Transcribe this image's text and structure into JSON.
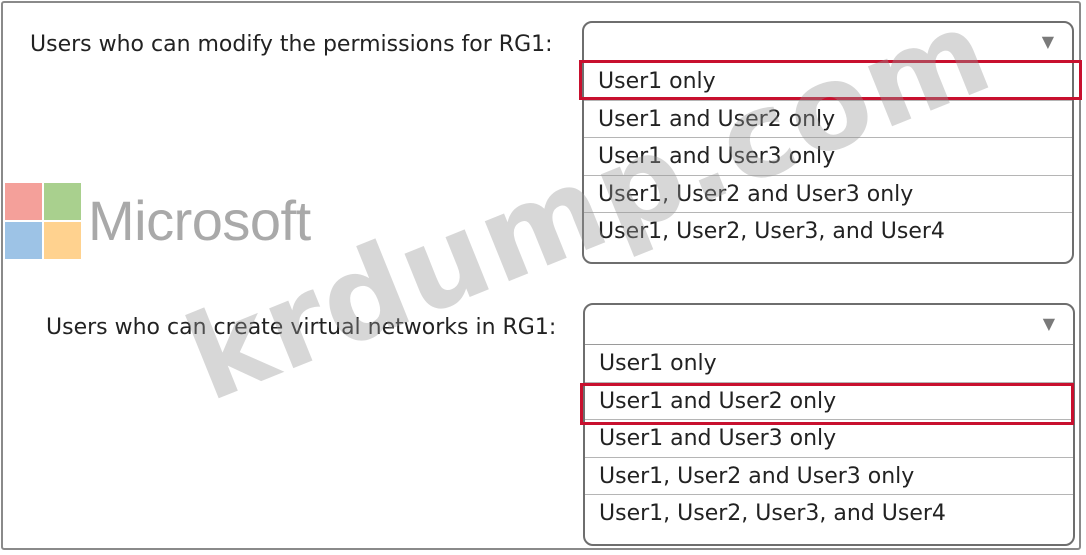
{
  "questions": [
    {
      "label": "Users who can modify the permissions for RG1:",
      "selected_value": "",
      "options": [
        "User1 only",
        "User1 and User2 only",
        "User1 and User3 only",
        "User1, User2 and User3 only",
        "User1, User2, User3, and User4"
      ],
      "highlighted_option": "User1 only"
    },
    {
      "label": "Users who can create virtual networks in RG1:",
      "selected_value": "",
      "options": [
        "User1 only",
        "User1 and User2 only",
        "User1 and User3 only",
        "User1, User2 and User3 only",
        "User1, User2, User3, and User4"
      ],
      "highlighted_option": "User1 and User2 only"
    }
  ],
  "watermark": {
    "brand": "Microsoft",
    "site": "krdump.com",
    "logo_colors": [
      "#f4a09a",
      "#a9d08e",
      "#9dc3e6",
      "#ffd28f"
    ]
  },
  "colors": {
    "highlight": "#c8102e"
  }
}
